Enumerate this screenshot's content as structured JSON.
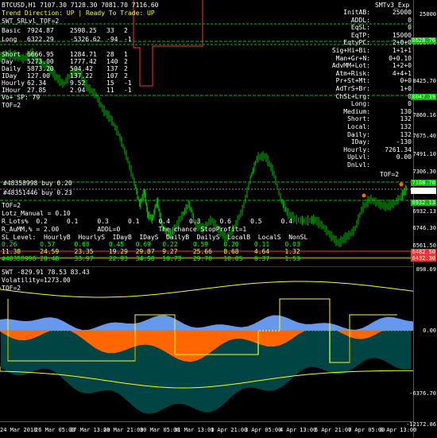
{
  "header": {
    "symbol_line": "BTCUSD,H1  7107.30 7128.30 7081.70 7116.60",
    "trend_line": "Trend Direction:  UP  |  Ready To Trade:  UP",
    "indicator_name": "SWT_SRLvl_TOF=2",
    "expert_name": "SMTv3_Exp"
  },
  "stats_table": [
    {
      "label": "Basic",
      "a": "7924.87",
      "b": "2598.25",
      "c": "33",
      "d": "2"
    },
    {
      "label": "Long",
      "a": "6322.29",
      "b": "-5326.62",
      "c": "-94",
      "d": "-1"
    },
    {
      "label": "Short",
      "a": "6666.95",
      "b": "1284.71",
      "c": "28",
      "d": "1"
    },
    {
      "label": "Day",
      "a": "5273.00",
      "b": "1777.42",
      "c": "140",
      "d": "2"
    },
    {
      "label": "Daily",
      "a": "5873.20",
      "b": "504.42",
      "c": "137",
      "d": "2"
    },
    {
      "label": "IDay",
      "a": "127.00",
      "b": "137.22",
      "c": "107",
      "d": "2"
    },
    {
      "label": "Hourly",
      "a": "62.34",
      "b": "9.52",
      "c": "15",
      "d": "-1"
    },
    {
      "label": "IHour",
      "a": "27.85",
      "b": "2.94",
      "c": "11",
      "d": "-1"
    }
  ],
  "left_notes": [
    "Vo+ SP: 79",
    "TOF=2"
  ],
  "right_panel": [
    "InitAB:",
    "ADDL:",
    "EqSL:",
    "EqTP:",
    "EqtyPC:",
    "Sig+Hi+Bi:",
    "Man+Gr+N:",
    "AdvMM+Lot:",
    "Atm+Risk:",
    "Pr+St+Mt:",
    "AdTrS+Br:",
    "ChSL+Lrg:",
    "Long:",
    "Medium:",
    "Short:",
    "Local:",
    "Daily:",
    "IDay:",
    "Hourly:",
    "UpLvl:",
    "DnLvl:"
  ],
  "right_values": [
    "25000",
    "0",
    "0",
    "15000",
    "",
    "2+0+0",
    "1+1+1",
    "0+0.10",
    "1+2+0",
    "4+4+1",
    "0+0",
    "1+0",
    "0",
    "0",
    "130",
    "132",
    "132",
    "132",
    "-130",
    "7261.34",
    "0.00"
  ],
  "right_footer": "TOF=2",
  "orders": [
    {
      "text": "#48358998 buy 0.20"
    },
    {
      "text": "#48351446 buy 0.23"
    }
  ],
  "lower_info": {
    "tof": "TOF=2",
    "lotz": "Lotz_Manual = 0.10",
    "rlots": "R_Lots%  0.2     0.1     0.3     0.1     0.4     0.3     0.6     0.5     0.4",
    "aumm": "R_AuMM,% = 2.00          ADDL=0          The chance StopProfit=1",
    "sl_header": "SL_Level:  HourlyB  HourlyS  IDayB  IDayS  DailyB  DailyS  LocalB  LocalS  NonSL",
    "sl_row1": "0.26      0.57     0.68     0.45   0.69   0.22    0.59    0.20    0.11    0.03",
    "sl_row2": "11.38     24.59    23.35    19.29  29.87  9.27    25.66   8.68    4.64    1.32",
    "sl_row3": "#48358998 20.48    33.97    22.93  34.58  10.73   29.70   10.05   6.37    1.53"
  },
  "price_axis": [
    "25000",
    "8628.76",
    "8425.70",
    "8047.39",
    "7860.16",
    "7675.40",
    "7491.10",
    "7306.30",
    "7188.70",
    "7116.60",
    "6932.13",
    "6746.30",
    "6561.50",
    "6462.60",
    "6373.60",
    "898.69",
    "0.00",
    "-6376.70",
    "-12172.86"
  ],
  "price_tags": [
    {
      "text": "8628.76",
      "bg": "#00c000"
    },
    {
      "text": "8047.39",
      "bg": "#00c000"
    },
    {
      "text": "7188.70",
      "bg": "#00c000"
    },
    {
      "text": "7116.60",
      "bg": "#ffffff"
    },
    {
      "text": "6932.13",
      "bg": "#00c000"
    },
    {
      "text": "6482.50",
      "bg": "#ff3030"
    },
    {
      "text": "6432.30",
      "bg": "#ff3030"
    }
  ],
  "sub": {
    "title": "SWT -829.91 78.53 83.43",
    "volatility": "Volatility=1273.00",
    "tof": "TOF=2"
  },
  "time_axis": [
    "24 Mar 2018",
    "26 Mar 05:00",
    "27 Mar 13:00",
    "28 Mar 21:00",
    "30 Mar 05:00",
    "31 Mar 13:00",
    "1 Apr 21:00",
    "3 Apr 05:00",
    "4 Apr 13:00",
    "5 Apr 21:00",
    "7 Apr 05:00",
    "8 Apr 13:00"
  ],
  "colors": {
    "candle": "#00c000",
    "grid_green": "#00c000",
    "red_line": "#ff3030",
    "yellow": "#ffff00",
    "orange": "#ff6600",
    "blue": "#6699ee",
    "teal": "#008888"
  }
}
